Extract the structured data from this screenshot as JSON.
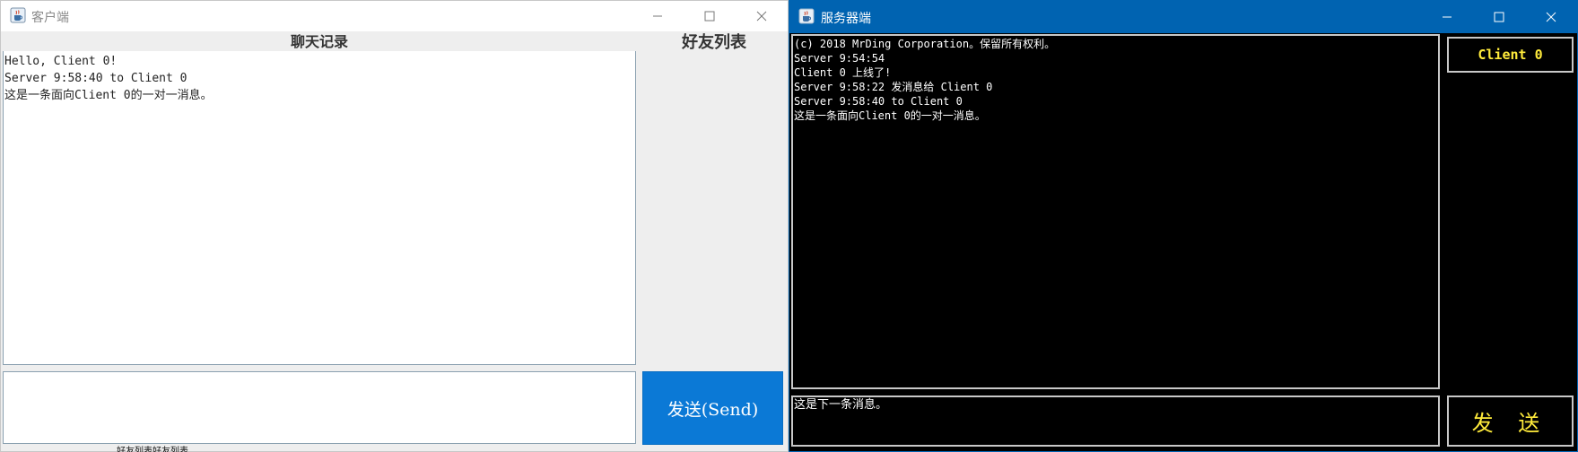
{
  "client": {
    "title": "客户端",
    "chat_header": "聊天记录",
    "chat_lines": [
      "Hello, Client 0!",
      "Server 9:58:40 to Client 0",
      "这是一条面向Client 0的一对一消息。"
    ],
    "friends_header": "好友列表",
    "input_value": "",
    "send_label": "发送(Send)"
  },
  "background": {
    "partial_text": "好友列表好友列表"
  },
  "server": {
    "title": "服务器端",
    "log_lines": [
      "(c) 2018 MrDing Corporation。保留所有权利。",
      "Server 9:54:54",
      "Client 0 上线了!",
      "Server 9:58:22 发消息给 Client 0",
      "Server 9:58:40 to Client 0",
      "这是一条面向Client 0的一对一消息。"
    ],
    "input_value": "这是下一条消息。",
    "client_list": [
      "Client 0"
    ],
    "send_label": "发 送"
  },
  "colors": {
    "client_send_bg": "#0b79d6",
    "server_titlebar_bg": "#0063b1",
    "server_accent": "#ffeb3b"
  },
  "icons": {
    "app": "java-cup-icon",
    "minimize": "minimize-icon",
    "maximize": "maximize-icon",
    "close": "close-icon"
  }
}
